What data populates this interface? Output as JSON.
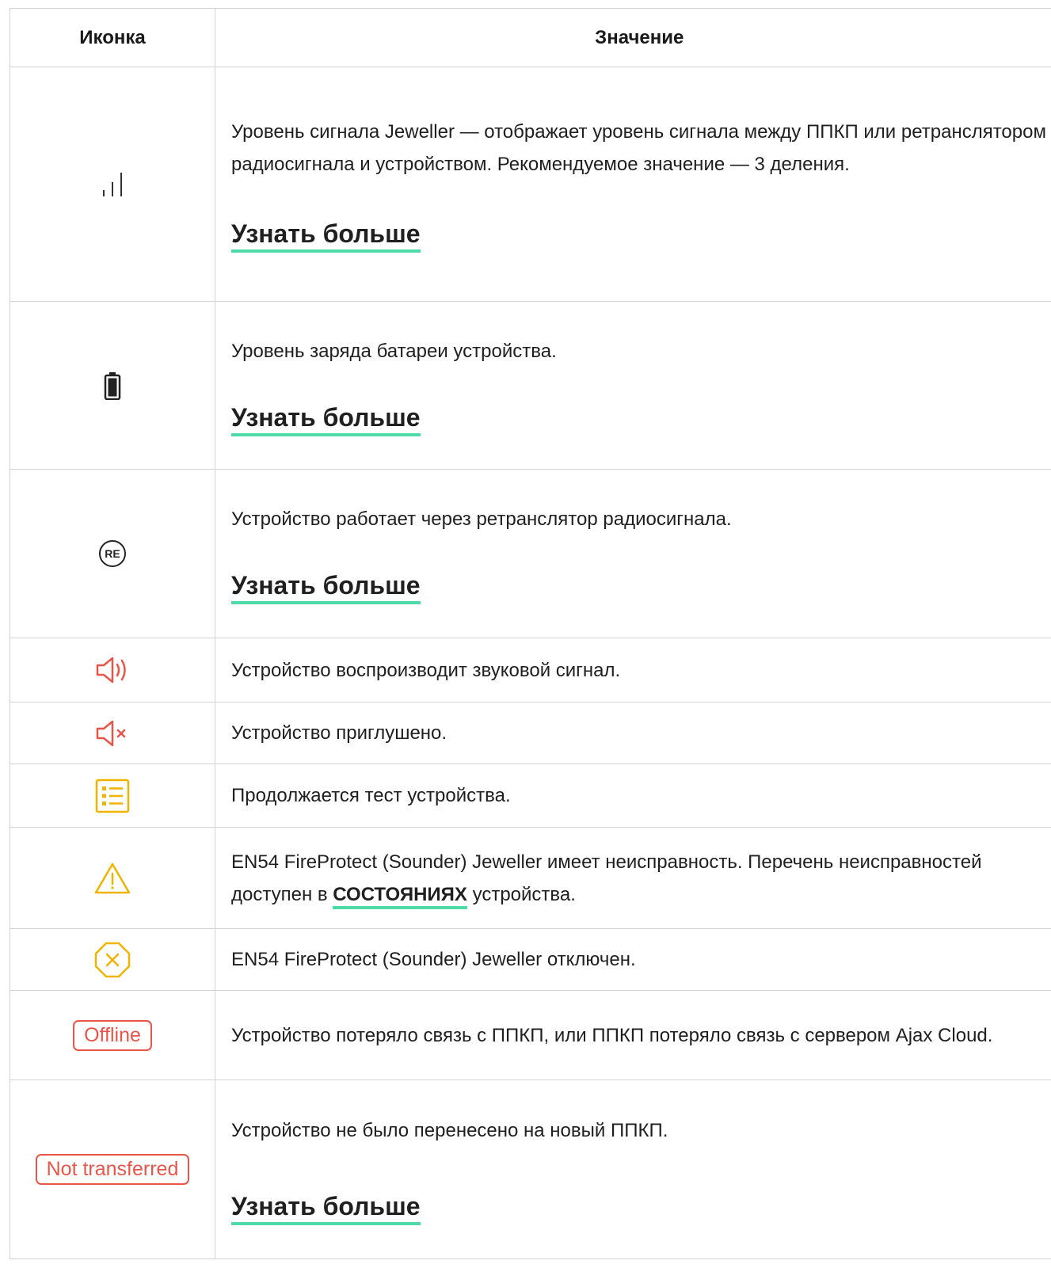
{
  "table": {
    "headers": {
      "icon": "Иконка",
      "meaning": "Значение"
    },
    "rows": [
      {
        "icon": "signal-strength-icon",
        "text": "Уровень сигнала Jeweller — отображает уровень сигнала между ППКП или ретранслятором радиосигнала и устройством. Рекомендуемое значение — 3 деления.",
        "link": "Узнать больше"
      },
      {
        "icon": "battery-icon",
        "text": "Уровень заряда батареи устройства.",
        "link": "Узнать больше"
      },
      {
        "icon": "re-icon",
        "icon_text": "RE",
        "text": "Устройство работает через ретранслятор радиосигнала.",
        "link": "Узнать больше"
      },
      {
        "icon": "speaker-sound-icon",
        "text": "Устройство воспроизводит звуковой сигнал."
      },
      {
        "icon": "speaker-muted-icon",
        "text": "Устройство приглушено."
      },
      {
        "icon": "checklist-icon",
        "text": "Продолжается тест устройства."
      },
      {
        "icon": "warning-triangle-icon",
        "text_before": "EN54 FireProtect (Sounder) Jeweller имеет неисправность. Перечень неисправностей доступен в ",
        "inline_link": "СОСТОЯНИЯХ",
        "text_after": " устройства."
      },
      {
        "icon": "disabled-octagon-icon",
        "text": "EN54 FireProtect (Sounder) Jeweller отключен."
      },
      {
        "badge": "Offline",
        "text": "Устройство потеряло связь с ППКП, или ППКП потеряло связь с сервером Ajax Cloud."
      },
      {
        "badge": "Not transferred",
        "text": "Устройство не было перенесено на новый ППКП.",
        "link": "Узнать больше"
      }
    ]
  },
  "colors": {
    "link_underline": "#4fdba7",
    "alert_red": "#ea5549",
    "warning_yellow": "#f0b400",
    "border": "#d3d3d3"
  }
}
